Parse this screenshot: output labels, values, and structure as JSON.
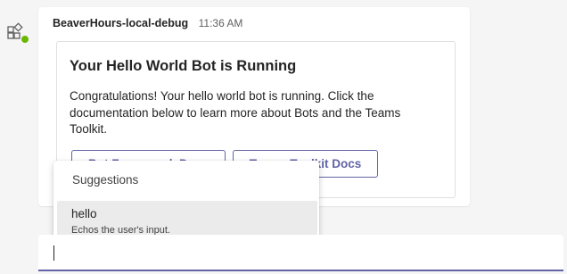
{
  "message": {
    "sender": "BeaverHours-local-debug",
    "timestamp": "11:36 AM",
    "bot_icon": "apps-grid-icon",
    "presence_color": "#6bb700"
  },
  "card": {
    "title": "Your Hello World Bot is Running",
    "body": "Congratulations! Your hello world bot is running. Click the documentation below to learn more about Bots and the Teams Toolkit.",
    "buttons": [
      {
        "label": "Bot Framework Docs"
      },
      {
        "label": "Teams Toolkit Docs"
      }
    ]
  },
  "suggestions": {
    "title": "Suggestions",
    "items": [
      {
        "command": "hello",
        "description": "Echos the user's input."
      }
    ]
  },
  "compose": {
    "value": ""
  },
  "colors": {
    "accent": "#6264a7",
    "background": "#f5f5f5"
  }
}
